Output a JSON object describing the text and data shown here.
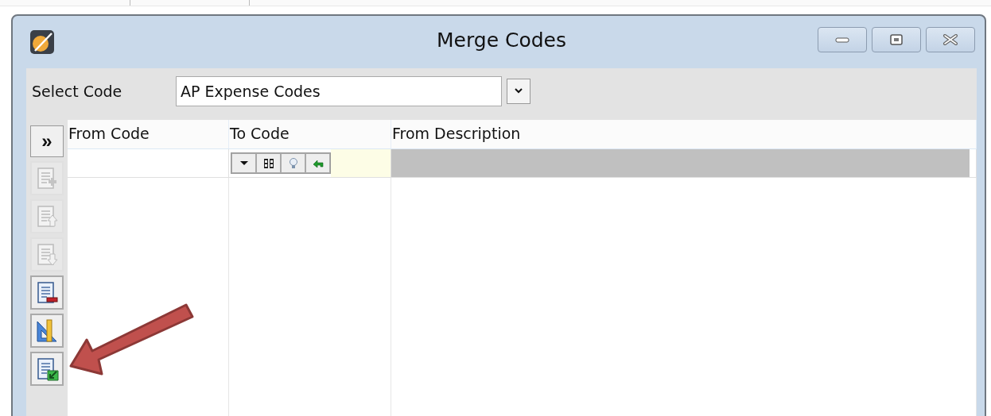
{
  "window": {
    "title": "Merge Codes"
  },
  "select_code": {
    "label": "Select Code",
    "value": "AP Expense Codes"
  },
  "expand_button": {
    "label": "»"
  },
  "side_toolbar": [
    {
      "kind": "add",
      "disabled": true
    },
    {
      "kind": "move-up",
      "disabled": true
    },
    {
      "kind": "move-down",
      "disabled": true
    },
    {
      "kind": "remove",
      "disabled": false
    },
    {
      "kind": "ruler",
      "disabled": false
    },
    {
      "kind": "export",
      "disabled": false
    }
  ],
  "table": {
    "columns": [
      "From Code",
      "To Code",
      "From Description"
    ],
    "filter_tools": [
      {
        "kind": "dropdown"
      },
      {
        "kind": "binoculars"
      },
      {
        "kind": "bulb"
      },
      {
        "kind": "undo"
      }
    ]
  },
  "annotation": {
    "kind": "arrow"
  }
}
